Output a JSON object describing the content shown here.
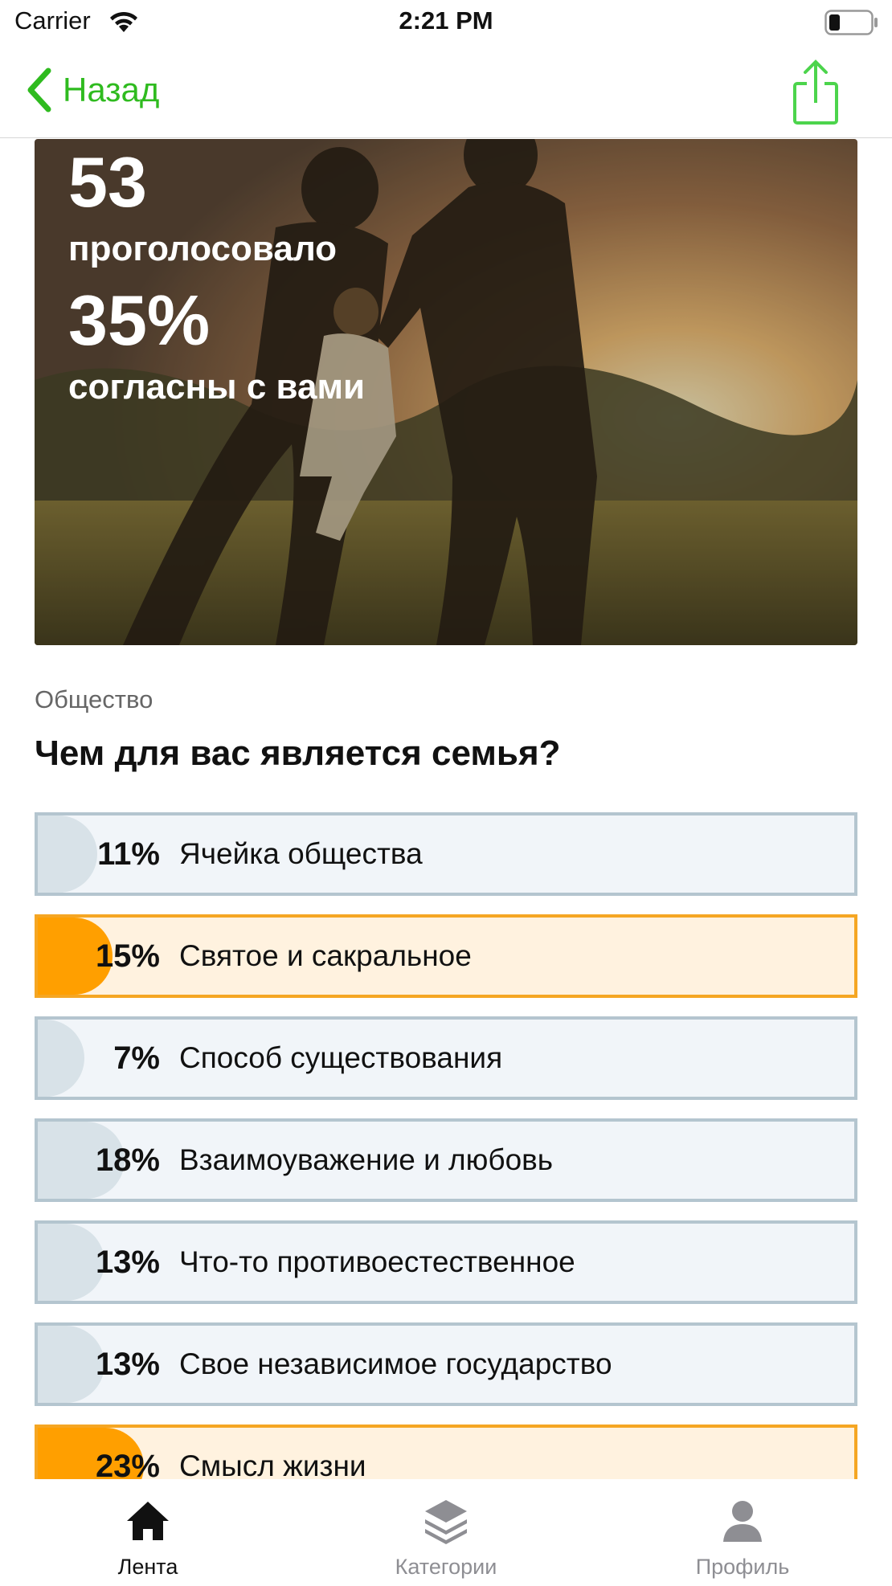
{
  "status_bar": {
    "carrier": "Carrier",
    "time": "2:21 PM",
    "battery_level": 0.25
  },
  "nav": {
    "back_label": "Назад",
    "back_icon": "chevron-left-icon",
    "share_icon": "share-icon"
  },
  "colors": {
    "accent": "#2fbb1f",
    "selected_border": "#f5a623",
    "selected_fill": "#ff9f00",
    "answer_border": "#b4c5cf"
  },
  "hero": {
    "votes": "53",
    "votes_label": "проголосовало",
    "agree": "35%",
    "agree_label": "согласны с вами"
  },
  "category": "Общество",
  "question": "Чем для вас является семья?",
  "answers": [
    {
      "percent_text": "11%",
      "percent": 11,
      "label": "Ячейка общества",
      "selected": false
    },
    {
      "percent_text": "15%",
      "percent": 15,
      "label": "Святое и сакральное",
      "selected": true
    },
    {
      "percent_text": "7%",
      "percent": 7,
      "label": "Способ существования",
      "selected": false
    },
    {
      "percent_text": "18%",
      "percent": 18,
      "label": "Взаимоуважение и любовь",
      "selected": false
    },
    {
      "percent_text": "13%",
      "percent": 13,
      "label": "Что-то противоестественное",
      "selected": false
    },
    {
      "percent_text": "13%",
      "percent": 13,
      "label": "Свое независимое государство",
      "selected": false
    },
    {
      "percent_text": "23%",
      "percent": 23,
      "label": "Смысл жизни",
      "selected": true
    }
  ],
  "tabs": [
    {
      "label": "Лента",
      "icon": "home-icon",
      "active": true
    },
    {
      "label": "Категории",
      "icon": "layers-icon",
      "active": false
    },
    {
      "label": "Профиль",
      "icon": "person-icon",
      "active": false
    }
  ]
}
